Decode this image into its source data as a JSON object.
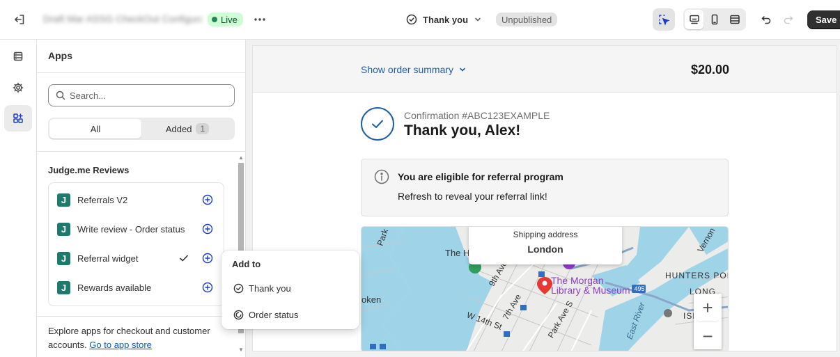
{
  "topbar": {
    "title": "Draft Mar ASSG CheckOut Configuration",
    "live_label": "Live",
    "page_name": "Thank you",
    "status_label": "Unpublished",
    "save_label": "Save"
  },
  "panel": {
    "title": "Apps",
    "search_placeholder": "Search...",
    "tabs": [
      {
        "label": "All"
      },
      {
        "label": "Added",
        "count": "1"
      }
    ],
    "section_title": "Judge.me Reviews",
    "apps": [
      {
        "name": "Referrals V2",
        "logo": "J"
      },
      {
        "name": "Write review - Order status",
        "logo": "J"
      },
      {
        "name": "Referral widget",
        "logo": "J"
      },
      {
        "name": "Rewards available",
        "logo": "J"
      }
    ],
    "footer_text": "Explore apps for checkout and customer accounts.",
    "footer_link": "Go to app store"
  },
  "popover": {
    "title": "Add to",
    "items": [
      {
        "label": "Thank you",
        "icon": "check-circle-icon"
      },
      {
        "label": "Order status",
        "icon": "order-status-icon"
      }
    ]
  },
  "preview": {
    "summary_link": "Show order summary",
    "summary_total": "$20.00",
    "confirmation_number": "Confirmation #ABC123EXAMPLE",
    "thank_you_title": "Thank you, Alex!",
    "notice_title": "You are eligible for referral program",
    "notice_body": "Refresh to reveal your referral link!",
    "map": {
      "shipping_label": "Shipping address",
      "shipping_city": "London",
      "poi_line1": "The Morgan",
      "poi_line2": "Library & Museum",
      "labels": [
        "Park",
        "The H",
        "9th Ave",
        "7th Ave",
        "W 14th St",
        "Park Ave S",
        "oken",
        "HUNTERS POIN",
        "LONG",
        "ISLAND",
        "East River",
        "Vernon",
        "495"
      ],
      "zoom_in": "+",
      "zoom_out": "−"
    }
  },
  "colors": {
    "accent": "#1f5fa6",
    "live_bg": "#cdfed4",
    "live_dot": "#29845a",
    "app_logo": "#1f7a6d",
    "link": "#005bd3",
    "water": "#9ed3e8"
  }
}
